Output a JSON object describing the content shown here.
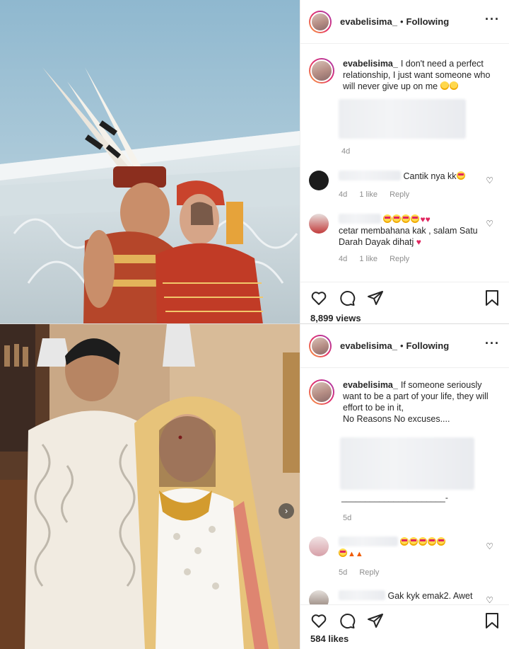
{
  "post1": {
    "username": "evabelisima_",
    "follow_label": "Following",
    "caption_user": "evabelisima_",
    "caption_text": "I don't need a perfect relationship, I just want someone who will never give up on me",
    "caption_time": "4d",
    "comments": [
      {
        "text": "Cantik nya kk",
        "time": "4d",
        "likes": "1 like",
        "reply": "Reply"
      },
      {
        "text": "cetar membahana kak , salam Satu Darah Dayak dihatj",
        "time": "4d",
        "likes": "1 like",
        "reply": "Reply"
      }
    ],
    "views": "8,899 views"
  },
  "post2": {
    "username": "evabelisima_",
    "follow_label": "Following",
    "caption_user": "evabelisima_",
    "caption_text": "If someone seriously want to be a part of your life, they will effort to be in it,",
    "caption_line2": "No Reasons No excuses....",
    "caption_dash": "______________________-",
    "caption_time": "5d",
    "comments": [
      {
        "time": "5d",
        "reply": "Reply"
      },
      {
        "text": "Gak kyk emak2. Awet"
      }
    ],
    "likes": "584 likes"
  },
  "icons": [
    "heart-icon",
    "comment-icon",
    "share-icon",
    "bookmark-icon",
    "more-icon",
    "carousel-next-icon"
  ],
  "colors": {
    "accent": "#262626",
    "muted": "#8e8e8e",
    "divider": "#efefef",
    "like_red": "#e0245e"
  }
}
